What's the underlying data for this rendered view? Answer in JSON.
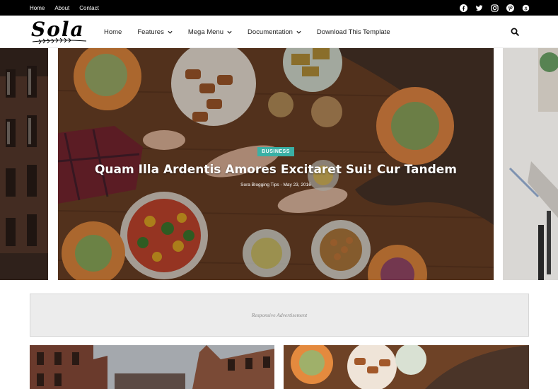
{
  "topbar": {
    "links": [
      "Home",
      "About",
      "Contact"
    ],
    "social": [
      "facebook-icon",
      "twitter-icon",
      "instagram-icon",
      "pinterest-icon",
      "skype-icon"
    ]
  },
  "header": {
    "logo_text": "Sola",
    "nav": [
      {
        "label": "Home",
        "dropdown": false
      },
      {
        "label": "Features",
        "dropdown": true
      },
      {
        "label": "Mega Menu",
        "dropdown": true
      },
      {
        "label": "Documentation",
        "dropdown": true
      },
      {
        "label": "Download This Template",
        "dropdown": false
      }
    ]
  },
  "slider": {
    "badge": "BUSINESS",
    "title": "Quam Illa Ardentis Amores Excitaret Sui! Cur Tandem",
    "author": "Sora Blogging Tips",
    "date": "May 23, 2016"
  },
  "ad": {
    "label": "Responsive Advertisement"
  },
  "colors": {
    "accent": "#3ab0a5",
    "topbar": "#000000"
  }
}
